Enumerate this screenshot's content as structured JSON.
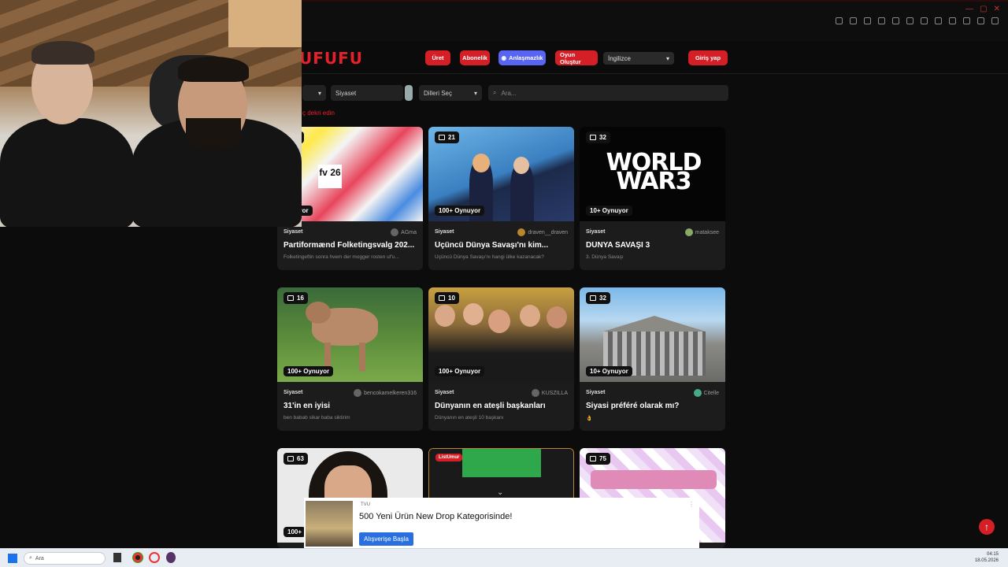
{
  "header": {
    "logo": "UFUFU",
    "buttons": [
      "Üret",
      "Abonelik",
      "Anlaşmazlık",
      "Oyun Oluştur"
    ],
    "language": "İngilizce",
    "login": "Giriş yap"
  },
  "filters": {
    "category": "Siyaset",
    "language_select": "Dilleri Seç",
    "search_placeholder": "Ara..."
  },
  "red_link": "ç dekri edin",
  "cards": [
    {
      "count": "2",
      "plays": "ynuyor",
      "category": "Siyaset",
      "author": "AGma",
      "title": "Partiformænd Folketingsvalg 202...",
      "desc": "Folketingeftin sonra hvem der mogger rosten uf'u..."
    },
    {
      "count": "21",
      "plays": "100+ Oynuyor",
      "category": "Siyaset",
      "author": "draven__draven",
      "title": "Üçüncü Dünya Savaşı'nı kim...",
      "desc": "Üçüncü Dünya Savaşı'nı hangi ülke kazanacak?"
    },
    {
      "count": "32",
      "plays": "10+ Oynuyor",
      "category": "Siyaset",
      "author": "mataksee",
      "title": "DÜNYA SAVAŞI 3",
      "desc": "3. Dünya Savaşı"
    },
    {
      "count": "16",
      "plays": "100+ Oynuyor",
      "category": "Siyaset",
      "author": "bencokamelkeren316",
      "title": "31'in en iyisi",
      "desc": "ben babab sikar baba siktirim"
    },
    {
      "count": "10",
      "plays": "100+ Oynuyor",
      "category": "Siyaset",
      "author": "KUSZILLA",
      "title": "Dünyanın en ateşli başkanları",
      "desc": "Dünyanın en ateşli 10 başkanı"
    },
    {
      "count": "32",
      "plays": "10+ Oynuyor",
      "category": "Siyaset",
      "author": "Citelle",
      "title": "Siyasi préféré olarak mı?",
      "desc": "👌"
    },
    {
      "count": "63",
      "plays": "100+",
      "category": "",
      "author": "",
      "title": "",
      "desc": ""
    },
    {
      "count": "",
      "plays": "",
      "category": "",
      "author": "",
      "title": "",
      "desc": "",
      "tag": "ListUmur"
    },
    {
      "count": "75",
      "plays": "",
      "category": "",
      "author": "",
      "title": "",
      "desc": ""
    }
  ],
  "thumb_text": {
    "card1": "fv 26",
    "card3": "WORLD WAR3"
  },
  "ad": {
    "brand": "TVU",
    "title": "500 Yeni Ürün New Drop Kategorisinde!",
    "button": "Alışverişe Başla"
  },
  "taskbar": {
    "search": "Ara",
    "time": "04:15",
    "date": "18.05.2026"
  },
  "colors": {
    "accent": "#e3212b",
    "discord": "#5865f2",
    "card_bg": "#1c1c1c"
  }
}
